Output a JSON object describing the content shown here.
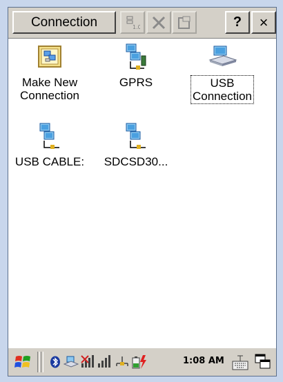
{
  "title_button": "Connection",
  "toolbar": {
    "help_label": "?",
    "close_label": "×"
  },
  "items": [
    {
      "label_line1": "Make New",
      "label_line2": "Connection",
      "icon": "make-new-connection-icon"
    },
    {
      "label_line1": "GPRS",
      "label_line2": "",
      "icon": "network-connection-icon"
    },
    {
      "label_line1": "USB",
      "label_line2": "Connection",
      "icon": "usb-computer-icon"
    },
    {
      "label_line1": "USB CABLE:",
      "label_line2": "",
      "icon": "network-connection-icon"
    },
    {
      "label_line1": "SDCSD30...",
      "label_line2": "",
      "icon": "network-connection-icon"
    }
  ],
  "taskbar": {
    "time": "1:08 AM"
  },
  "colors": {
    "background": "#c8d6ec",
    "chrome": "#d4d0c8"
  }
}
